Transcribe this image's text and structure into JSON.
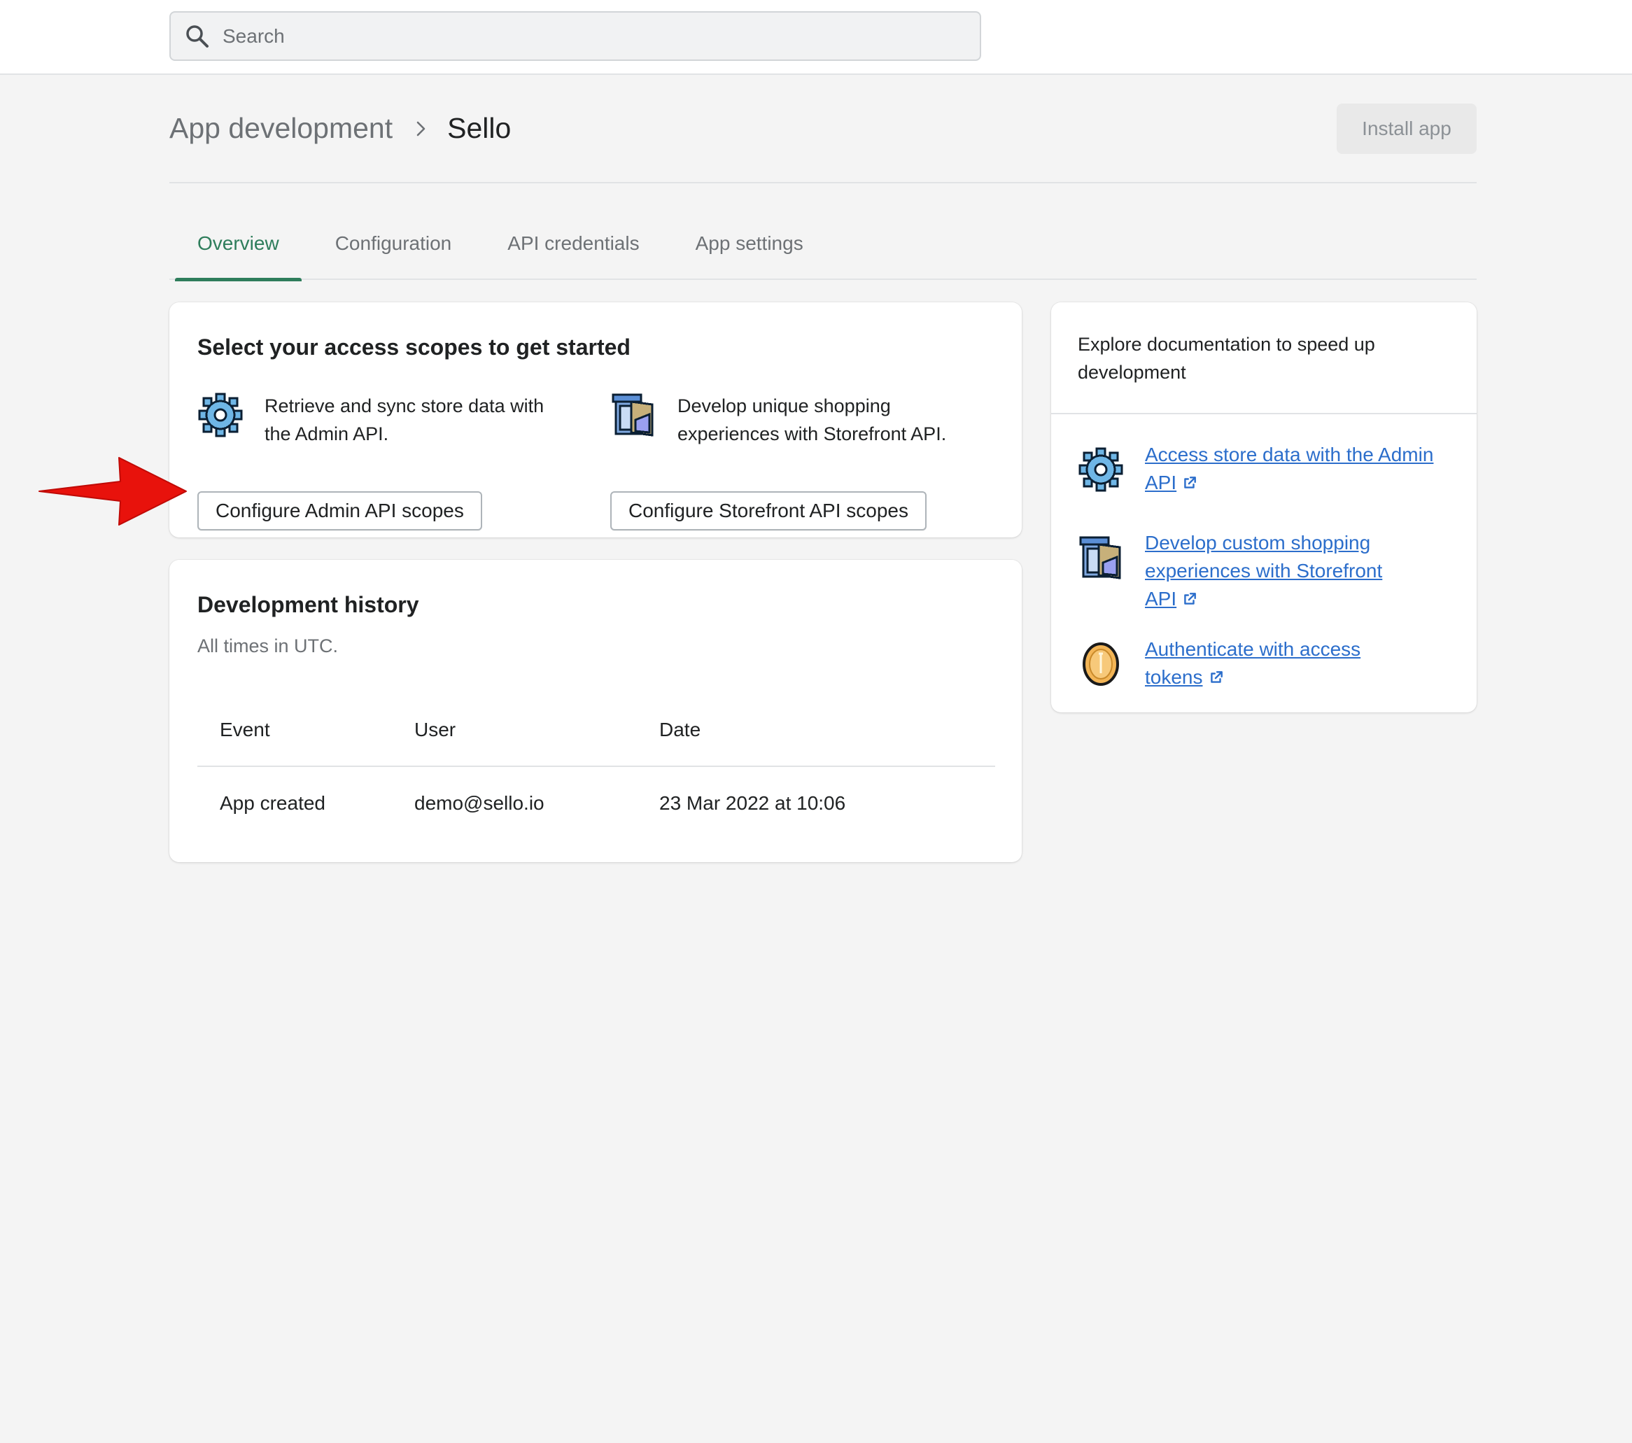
{
  "search": {
    "placeholder": "Search"
  },
  "header": {
    "breadcrumb_parent": "App development",
    "title": "Sello",
    "install_label": "Install app"
  },
  "tabs": [
    {
      "label": "Overview",
      "active": true
    },
    {
      "label": "Configuration",
      "active": false
    },
    {
      "label": "API credentials",
      "active": false
    },
    {
      "label": "App settings",
      "active": false
    }
  ],
  "scopes": {
    "title": "Select your access scopes to get started",
    "admin": {
      "icon": "gear-icon",
      "desc_line1": "Retrieve and sync store data with",
      "desc_line2": "the Admin API.",
      "button": "Configure Admin API scopes"
    },
    "storefront": {
      "icon": "storefront-icon",
      "desc_line1": "Develop unique shopping",
      "desc_line2": "experiences with Storefront API.",
      "button": "Configure Storefront API scopes"
    }
  },
  "history": {
    "title": "Development history",
    "subtitle": "All times in UTC.",
    "columns": [
      "Event",
      "User",
      "Date"
    ],
    "rows": [
      [
        "App created",
        "demo@sello.io",
        "23 Mar 2022 at 10:06"
      ]
    ]
  },
  "docs": {
    "title_line1": "Explore documentation to speed up",
    "title_line2": "development",
    "links": [
      {
        "icon": "gear-icon",
        "line1": "Access store data with the Admin",
        "line2": "API",
        "line3": ""
      },
      {
        "icon": "storefront-icon",
        "line1": "Develop custom shopping",
        "line2": "experiences with Storefront",
        "line3": "API"
      },
      {
        "icon": "coin-icon",
        "line1": "Authenticate with access",
        "line2": "tokens",
        "line3": ""
      }
    ]
  },
  "colors": {
    "accent_tab": "#2e7d5b",
    "link": "#2c6ecb",
    "annotation_arrow": "#e8120c"
  }
}
